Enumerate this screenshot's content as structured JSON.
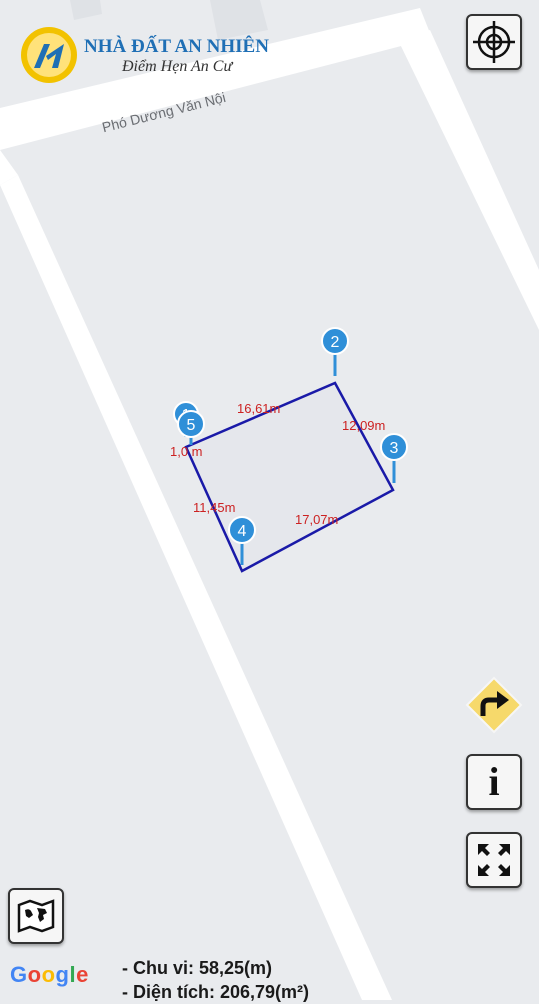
{
  "brand": {
    "name": "NHÀ ĐẤT AN NHIÊN",
    "slogan": "Điểm Hẹn An Cư",
    "logo_letters": "AN",
    "color_primary": "#1f6fb5",
    "color_accent": "#f2c200"
  },
  "map": {
    "street_name": "Phó Dương Văn Nội",
    "parcel": {
      "vertex_labels": [
        "1",
        "2",
        "3",
        "4",
        "5"
      ],
      "edge_labels": [
        "16,61m",
        "12,09m",
        "17,07m",
        "11,45m",
        "1,0 m"
      ],
      "outline_color": "#1a1aa8",
      "label_color": "#cc2222",
      "marker_color": "#2f8fd8"
    }
  },
  "controls": {
    "locate_icon": "crosshair-icon",
    "direction_icon": "turn-right-arrow-icon",
    "info_label": "i",
    "fullscreen_icon": "expand-icon",
    "layers_icon": "world-map-icon"
  },
  "attribution": {
    "letters": [
      "G",
      "o",
      "o",
      "g",
      "l",
      "e"
    ],
    "colors": [
      "#4285f4",
      "#ea4335",
      "#fbbc05",
      "#4285f4",
      "#34a853",
      "#ea4335"
    ]
  },
  "summary": {
    "perimeter": "- Chu vi: 58,25(m)",
    "area": "- Diện tích: 206,79(m²)"
  }
}
